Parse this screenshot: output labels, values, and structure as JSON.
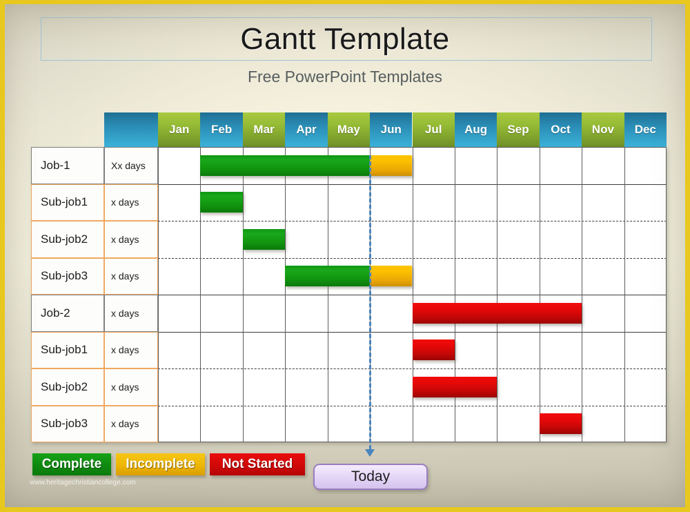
{
  "slide": {
    "title": "Gantt Template",
    "subtitle": "Free PowerPoint Templates",
    "watermark": "www.heritagechristiancollege.com",
    "border_color": "#e8c81f"
  },
  "gantt": {
    "corner_header_label": "",
    "months": [
      "Jan",
      "Feb",
      "Mar",
      "Apr",
      "May",
      "Jun",
      "Jul",
      "Aug",
      "Sep",
      "Oct",
      "Nov",
      "Dec"
    ],
    "header_colors": {
      "green_top": "#a7c93f",
      "green_bottom": "#6f8f27",
      "blue_top": "#1f6f94",
      "blue_bottom": "#3bb2da"
    },
    "rows": [
      {
        "name": "Job-1",
        "duration": "Xx days",
        "type": "job"
      },
      {
        "name": "Sub-job1",
        "duration": "x days",
        "type": "sub"
      },
      {
        "name": "Sub-job2",
        "duration": "x days",
        "type": "sub"
      },
      {
        "name": "Sub-job3",
        "duration": "x days",
        "type": "sub"
      },
      {
        "name": "Job-2",
        "duration": "x days",
        "type": "job"
      },
      {
        "name": "Sub-job1",
        "duration": "x days",
        "type": "sub"
      },
      {
        "name": "Sub-job2",
        "duration": "x days",
        "type": "sub"
      },
      {
        "name": "Sub-job3",
        "duration": "x days",
        "type": "sub"
      }
    ]
  },
  "today_marker": {
    "label": "Today",
    "month": "Jun",
    "line_color": "#4a84bd",
    "box_border_color": "#9b7ec4"
  },
  "legend": [
    {
      "label": "Complete",
      "status": "complete",
      "color": "#0f8a10"
    },
    {
      "label": "Incomplete",
      "status": "incomplete",
      "color": "#eeb606"
    },
    {
      "label": "Not Started",
      "status": "not-started",
      "color": "#d00808"
    }
  ],
  "chart_data": {
    "type": "bar",
    "title": "Gantt Template",
    "subtitle": "Free PowerPoint Templates",
    "xlabel": "",
    "ylabel": "",
    "categories": [
      "Jan",
      "Feb",
      "Mar",
      "Apr",
      "May",
      "Jun",
      "Jul",
      "Aug",
      "Sep",
      "Oct",
      "Nov",
      "Dec"
    ],
    "axis_months": 12,
    "today_month_index": 5,
    "grid": true,
    "legend_position": "bottom-left",
    "legend_entries": [
      "Complete",
      "Incomplete",
      "Not Started"
    ],
    "tasks": [
      {
        "name": "Job-1",
        "duration": "Xx days",
        "start_month": "Feb",
        "end_month": "Jul",
        "segments": [
          {
            "status": "complete",
            "start_month": "Feb",
            "end_month": "Jun",
            "color": "#12960f"
          },
          {
            "status": "incomplete",
            "start_month": "Jun",
            "end_month": "Jul",
            "color": "#fcc000"
          }
        ]
      },
      {
        "name": "Sub-job1",
        "duration": "x days",
        "start_month": "Feb",
        "end_month": "Feb",
        "segments": [
          {
            "status": "complete",
            "start_month": "Feb",
            "end_month": "Feb",
            "color": "#12960f"
          }
        ]
      },
      {
        "name": "Sub-job2",
        "duration": "x days",
        "start_month": "Mar",
        "end_month": "Mar",
        "segments": [
          {
            "status": "complete",
            "start_month": "Mar",
            "end_month": "Mar",
            "color": "#12960f"
          }
        ]
      },
      {
        "name": "Sub-job3",
        "duration": "x days",
        "start_month": "Apr",
        "end_month": "Jul",
        "segments": [
          {
            "status": "complete",
            "start_month": "Apr",
            "end_month": "Jun",
            "color": "#12960f"
          },
          {
            "status": "incomplete",
            "start_month": "Jun",
            "end_month": "Jul",
            "color": "#fcc000"
          }
        ]
      },
      {
        "name": "Job-2",
        "duration": "x days",
        "start_month": "Jul",
        "end_month": "Nov",
        "segments": [
          {
            "status": "not-started",
            "start_month": "Jul",
            "end_month": "Nov",
            "color": "#c40707"
          }
        ]
      },
      {
        "name": "Sub-job1",
        "duration": "x days",
        "start_month": "Jul",
        "end_month": "Jul",
        "segments": [
          {
            "status": "not-started",
            "start_month": "Jul",
            "end_month": "Jul",
            "color": "#c40707"
          }
        ]
      },
      {
        "name": "Sub-job2",
        "duration": "x days",
        "start_month": "Jul",
        "end_month": "Sep",
        "segments": [
          {
            "status": "not-started",
            "start_month": "Jul",
            "end_month": "Sep",
            "color": "#c40707"
          }
        ]
      },
      {
        "name": "Sub-job3",
        "duration": "x days",
        "start_month": "Oct",
        "end_month": "Nov",
        "segments": [
          {
            "status": "not-started",
            "start_month": "Oct",
            "end_month": "Nov",
            "color": "#c40707"
          }
        ]
      }
    ]
  }
}
